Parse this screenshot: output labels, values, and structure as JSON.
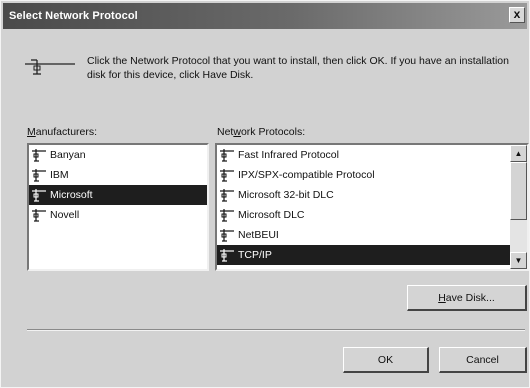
{
  "window": {
    "title": "Select Network Protocol",
    "close_glyph": "x"
  },
  "instructions": "Click the Network Protocol that you want to install, then click OK. If you have an installation disk for this device, click Have Disk.",
  "manufacturers": {
    "label_underlined": "M",
    "label_rest": "anufacturers:",
    "items": [
      {
        "label": "Banyan",
        "selected": false
      },
      {
        "label": "IBM",
        "selected": false
      },
      {
        "label": "Microsoft",
        "selected": true
      },
      {
        "label": "Novell",
        "selected": false
      }
    ]
  },
  "protocols": {
    "label_before": "Net",
    "label_underlined": "w",
    "label_after": "ork Protocols:",
    "items": [
      {
        "label": "Fast Infrared Protocol",
        "selected": false
      },
      {
        "label": "IPX/SPX-compatible Protocol",
        "selected": false
      },
      {
        "label": "Microsoft 32-bit DLC",
        "selected": false
      },
      {
        "label": "Microsoft DLC",
        "selected": false
      },
      {
        "label": "NetBEUI",
        "selected": false
      },
      {
        "label": "TCP/IP",
        "selected": true
      }
    ],
    "scroll_up_glyph": "▲",
    "scroll_down_glyph": "▼"
  },
  "buttons": {
    "have_disk_underlined": "H",
    "have_disk_rest": "ave Disk...",
    "ok": "OK",
    "cancel": "Cancel"
  },
  "colors": {
    "title_bar": "#4a4a4a",
    "face": "#d2d2d2",
    "selection": "#1e1e1e"
  },
  "icons": {
    "header": "network-cable-icon",
    "list_item": "network-protocol-icon"
  }
}
